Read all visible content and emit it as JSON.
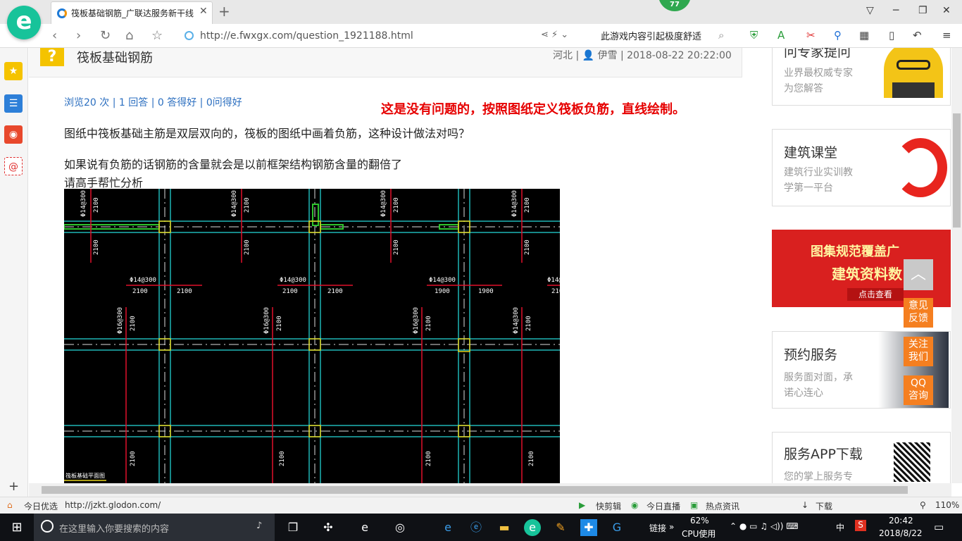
{
  "browser": {
    "tab_title": "筏板基础钢筋_广联达服务新干线",
    "tab_close": "✕",
    "new_tab": "+",
    "notification_badge": "77",
    "url": "http://e.fwxgx.com/question_1921188.html",
    "search_hint": "此游戏内容引起极度舒适",
    "window_controls": [
      "▽",
      "─",
      "❐",
      "✕"
    ]
  },
  "question": {
    "title": "筏板基础钢筋",
    "meta": "河北 | 👤 伊雪 | 2018-08-22 20:22:00",
    "stats": "浏览20 次 | 1 回答 | 0 答得好 | 0问得好",
    "line1": "图纸中筏板基础主筋是双层双向的，筏板的图纸中画着负筋，这种设计做法对吗？",
    "line2": "如果说有负筋的话钢筋的含量就会是以前框架结构钢筋含量的翻倍了",
    "line3": "请高手帮忙分析",
    "answer_annotation": "这是没有问题的，按照图纸定义筏板负筋，直线绘制。",
    "qmark": "?"
  },
  "cad_labels": {
    "rebar_a": "Φ14@300",
    "rebar_b": "Φ16@300",
    "dim_2100": "2100",
    "dim_1900": "1900",
    "dim_210": "210",
    "footer": "筏板基础平面图"
  },
  "right_column": {
    "expert_title": "问专家提问",
    "expert_sub1": "业界最权威专家",
    "expert_sub2": "为您解答",
    "course_title": "建筑课堂",
    "course_sub1": "建筑行业实训教",
    "course_sub2": "学第一平台",
    "banner_line1": "图集规范覆盖广",
    "banner_line2": "建筑资料数",
    "banner_click": "点击查看",
    "service_title": "预约服务",
    "service_sub1": "服务面对面，承",
    "service_sub2": "诺心连心",
    "app_title": "服务APP下载",
    "app_sub": "您的掌上服务专"
  },
  "float_buttons": {
    "top": "︿",
    "feedback": "意见\n反馈",
    "follow": "关注\n我们",
    "qq": "QQ\n咨询"
  },
  "statusbar": {
    "left_label": "今日优选",
    "link_url": "http://jzkt.glodon.com/",
    "kuaijianji": "快剪辑",
    "live": "今日直播",
    "news": "热点资讯",
    "download": "下载",
    "zoom": "110%"
  },
  "taskbar": {
    "search_placeholder": "在这里输入你要搜索的内容",
    "link": "链接",
    "cpu_percent": "62%",
    "cpu_label": "CPU使用",
    "ime": "中",
    "time": "20:42",
    "date": "2018/8/22"
  }
}
